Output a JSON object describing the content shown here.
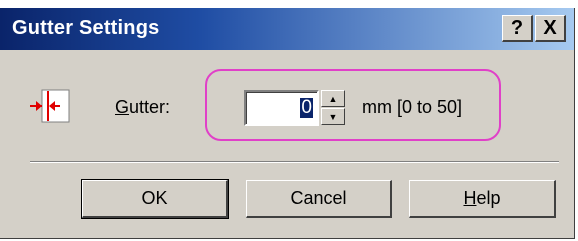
{
  "window": {
    "title": "Gutter Settings",
    "help_button_label": "?",
    "close_button_label": "X"
  },
  "gutter": {
    "label_underlined_char": "G",
    "label_rest": "utter:",
    "value": "0",
    "range_text": "mm [0 to 50]",
    "icon": "gutter-margin-icon"
  },
  "buttons": {
    "ok_label": "OK",
    "cancel_label": "Cancel",
    "help_underlined_char": "H",
    "help_rest": "elp"
  },
  "colors": {
    "title_gradient_start": "#0a246a",
    "title_gradient_end": "#a6caf0",
    "highlight_border": "#e040c8",
    "dialog_face": "#d4d0c8"
  }
}
